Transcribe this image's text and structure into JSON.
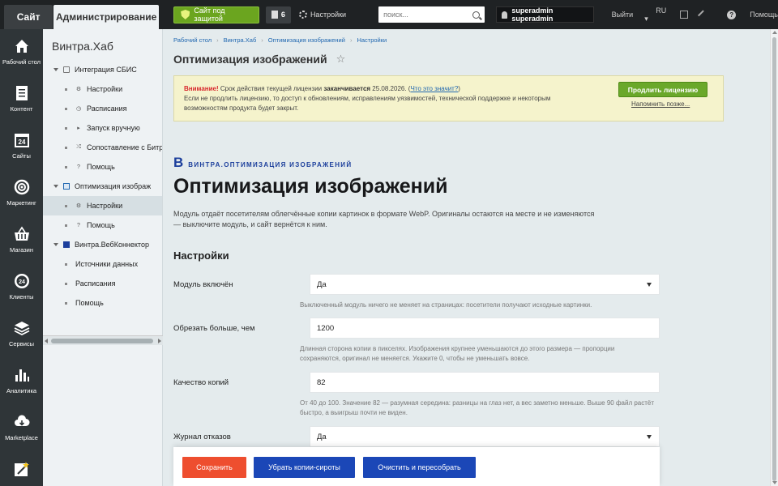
{
  "topbar": {
    "tab_site": "Сайт",
    "tab_admin": "Администрирование",
    "secure_label": "Сайт под защитой",
    "notifications_count": "6",
    "settings_label": "Настройки",
    "search_placeholder": "поиск...",
    "user_name": "superadmin superadmin",
    "logout_label": "Выйти",
    "lang_label": "RU",
    "help_label": "Помощь"
  },
  "iconbar": [
    {
      "label": "Рабочий стол",
      "icon": "house-icon"
    },
    {
      "label": "Контент",
      "icon": "document-icon"
    },
    {
      "label": "Сайты",
      "icon": "calendar-24-icon",
      "glyph": "24"
    },
    {
      "label": "Маркетинг",
      "icon": "target-icon"
    },
    {
      "label": "Магазин",
      "icon": "basket-icon"
    },
    {
      "label": "Клиенты",
      "icon": "clients-24-icon",
      "glyph": "24"
    },
    {
      "label": "Сервисы",
      "icon": "layers-icon"
    },
    {
      "label": "Аналитика",
      "icon": "bar-chart-icon"
    },
    {
      "label": "Marketplace",
      "icon": "cloud-download-icon"
    },
    {
      "label": "",
      "icon": "magic-wand-icon"
    }
  ],
  "tree": {
    "title": "Винтра.Хаб",
    "items": [
      {
        "label": "Интеграция СБИС",
        "level": 0,
        "icon": "module-icon"
      },
      {
        "label": "Настройки",
        "level": 1,
        "icon": "gear-icon"
      },
      {
        "label": "Расписания",
        "level": 1,
        "icon": "clock-icon"
      },
      {
        "label": "Запуск вручную",
        "level": 1,
        "icon": "play-icon"
      },
      {
        "label": "Сопоставление с Битр",
        "level": 1,
        "icon": "shuffle-icon"
      },
      {
        "label": "Помощь",
        "level": 1,
        "icon": "help-icon"
      },
      {
        "label": "Оптимизация изображ",
        "level": 0,
        "icon": "image-icon"
      },
      {
        "label": "Настройки",
        "level": 1,
        "icon": "gear-icon",
        "selected": true
      },
      {
        "label": "Помощь",
        "level": 1,
        "icon": "help-icon"
      },
      {
        "label": "Винтра.ВебКоннектор",
        "level": 0,
        "icon": "grid-icon"
      },
      {
        "label": "Источники данных",
        "level": 1,
        "icon": ""
      },
      {
        "label": "Расписания",
        "level": 1,
        "icon": ""
      },
      {
        "label": "Помощь",
        "level": 1,
        "icon": ""
      }
    ]
  },
  "breadcrumbs": [
    "Рабочий стол",
    "Винтра.Хаб",
    "Оптимизация изображений",
    "Настройки"
  ],
  "page_title": "Оптимизация изображений",
  "alert": {
    "warning": "Внимание!",
    "text1": " Срок действия текущей лицензии ",
    "expires_bold": "заканчивается",
    "date": " 25.08.2026. (",
    "link": "Что это значит?",
    "text2": ")",
    "text3": "Если не продлить лицензию, то доступ к обновлениям, исправлениям уязвимостей, технической поддержке и некоторым возможностям продукта будет закрыт.",
    "extend_button": "Продлить лицензию",
    "remind_link": "Напомнить позже..."
  },
  "brand": {
    "letter": "В",
    "name": "ВИНТРА.ОПТИМИЗАЦИЯ ИЗОБРАЖЕНИЙ"
  },
  "heading": "Оптимизация изображений",
  "description": "Модуль отдаёт посетителям облегчённые копии картинок в формате WebP. Оригиналы остаются на месте и не изменяются — выключите модуль, и сайт вернётся к ним.",
  "section_title": "Настройки",
  "fields": {
    "enabled": {
      "label": "Модуль включён",
      "value": "Да",
      "hint": "Выключенный модуль ничего не меняет на страницах: посетители получают исходные картинки."
    },
    "crop": {
      "label": "Обрезать больше, чем",
      "value": "1200",
      "hint": "Длинная сторона копии в пикселях. Изображения крупнее уменьшаются до этого размера — пропорции сохраняются, оригинал не меняется. Укажите 0, чтобы не уменьшать вовсе."
    },
    "quality": {
      "label": "Качество копий",
      "value": "82",
      "hint": "От 40 до 100. Значение 82 — разумная середина: разницы на глаз нет, а вес заметно меньше. Выше 90 файл растёт быстро, а выигрыш почти не виден."
    },
    "journal": {
      "label": "Журнал отказов",
      "value": "Да"
    }
  },
  "footer": {
    "save": "Сохранить",
    "remove_orphans": "Убрать копии-сироты",
    "clear_rebuild": "Очистить и пересобрать"
  },
  "colors": {
    "topbar_bg": "#1f2224",
    "secure_green": "#6ba51f",
    "save_red": "#ee4e2f",
    "action_blue": "#1b47b7",
    "brand_blue": "#1c3f9c",
    "alert_bg": "#f5f3cc"
  }
}
